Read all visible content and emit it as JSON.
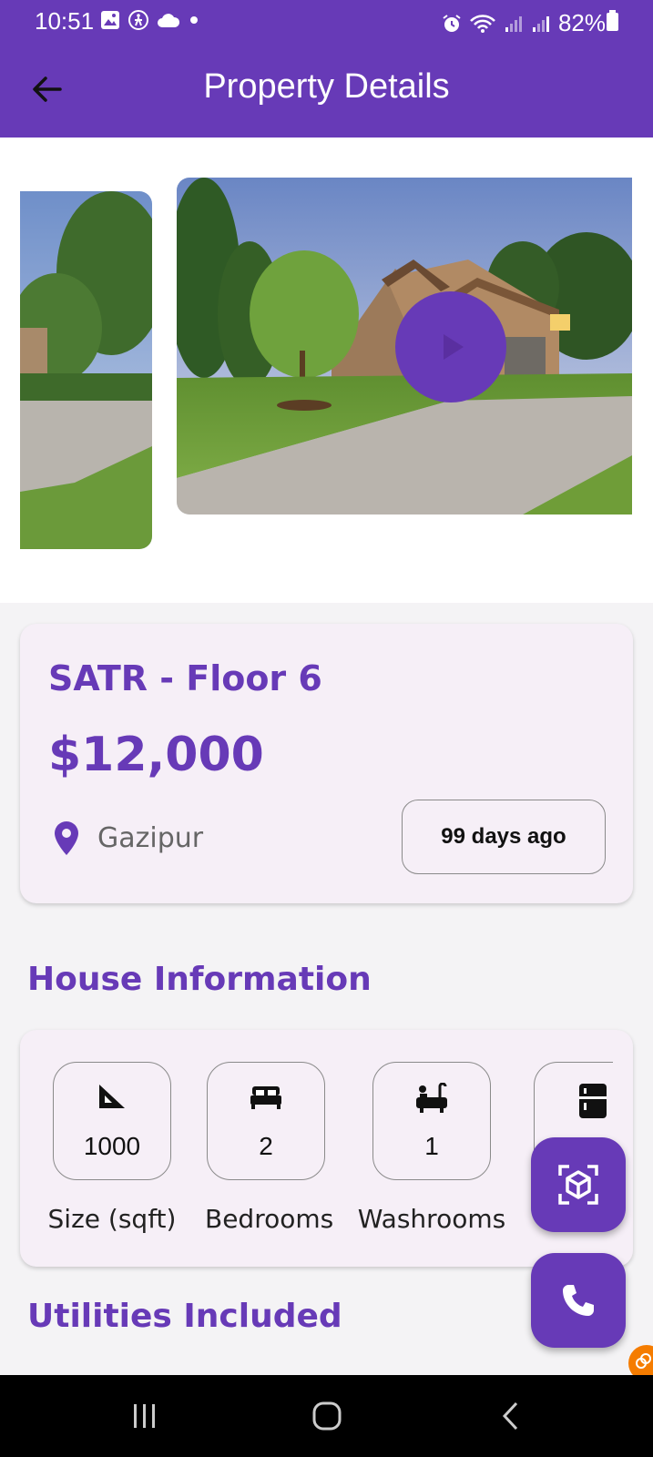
{
  "status_bar": {
    "time": "10:51",
    "battery": "82%"
  },
  "app_bar": {
    "title": "Property Details",
    "back_icon": "arrow-left-icon"
  },
  "carousel": {
    "play_icon": "play-icon"
  },
  "property": {
    "name": "SATR - Floor 6",
    "price": "$12,000",
    "location": "Gazipur",
    "posted": "99 days ago"
  },
  "house_information": {
    "title": "House Information",
    "items": [
      {
        "icon": "ruler-triangle-icon",
        "value": "1000",
        "label": "Size (sqft)"
      },
      {
        "icon": "bed-icon",
        "value": "2",
        "label": "Bedrooms"
      },
      {
        "icon": "bathtub-icon",
        "value": "1",
        "label": "Washrooms"
      },
      {
        "icon": "fridge-icon",
        "value": "",
        "label": ""
      }
    ]
  },
  "utilities": {
    "title": "Utilities Included"
  },
  "fabs": {
    "ar_icon": "ar-cube-icon",
    "call_icon": "phone-icon"
  },
  "colors": {
    "primary": "#673ab7",
    "card_bg": "#f6eff7",
    "page_bg": "#f4f3f5"
  }
}
